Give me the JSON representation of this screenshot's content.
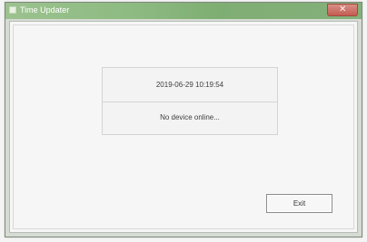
{
  "window": {
    "title": "Time Updater",
    "icon": "app-icon",
    "close_symbol": "✕"
  },
  "status": {
    "datetime": "2019-06-29 10:19:54",
    "message": "No device online..."
  },
  "buttons": {
    "exit_label": "Exit"
  },
  "colors": {
    "title_bar": "#8dbb82",
    "close_button": "#c45d52",
    "client_background": "#f6f6f6"
  }
}
